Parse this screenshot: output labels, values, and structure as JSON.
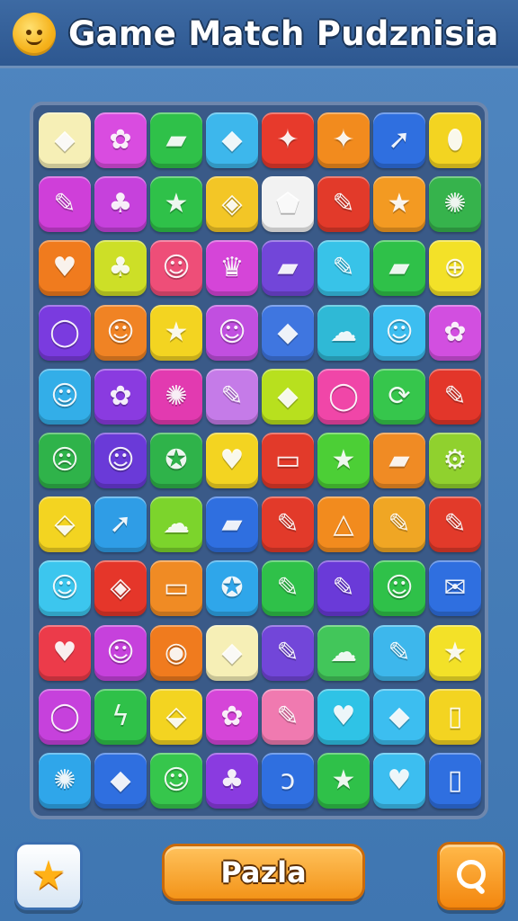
{
  "header": {
    "title": "Game Match Pudznisia",
    "icon": "smiley-face-icon"
  },
  "board": {
    "rows": 11,
    "cols": 8,
    "tiles": [
      [
        {
          "c": "#f6efb6",
          "g": "◆",
          "n": "gem"
        },
        {
          "c": "#d94ce0",
          "g": "✿",
          "n": "flower"
        },
        {
          "c": "#2fc149",
          "g": "▰",
          "n": "block"
        },
        {
          "c": "#3db7ec",
          "g": "◆",
          "n": "gem"
        },
        {
          "c": "#e73a2c",
          "g": "✦",
          "n": "splash"
        },
        {
          "c": "#f28b1e",
          "g": "✦",
          "n": "star-burst"
        },
        {
          "c": "#2f6fe0",
          "g": "➚",
          "n": "arrow"
        },
        {
          "c": "#f3d421",
          "g": "⬮",
          "n": "oval"
        }
      ],
      [
        {
          "c": "#cf3fd9",
          "g": "✎",
          "n": "brush"
        },
        {
          "c": "#c641dc",
          "g": "♣",
          "n": "sprout"
        },
        {
          "c": "#2fc149",
          "g": "★",
          "n": "star"
        },
        {
          "c": "#f3c626",
          "g": "◈",
          "n": "diamond"
        },
        {
          "c": "#f2f2f2",
          "g": "⬟",
          "n": "pentagon"
        },
        {
          "c": "#e23a2a",
          "g": "✎",
          "n": "pencil"
        },
        {
          "c": "#f39a22",
          "g": "★",
          "n": "star"
        },
        {
          "c": "#36b34c",
          "g": "✺",
          "n": "gear"
        }
      ],
      [
        {
          "c": "#f07b1e",
          "g": "♥",
          "n": "heart"
        },
        {
          "c": "#cddf27",
          "g": "♣",
          "n": "leaf"
        },
        {
          "c": "#ee4e78",
          "g": "☺",
          "n": "smiley"
        },
        {
          "c": "#d545d8",
          "g": "♛",
          "n": "crown"
        },
        {
          "c": "#7246d9",
          "g": "▰",
          "n": "block"
        },
        {
          "c": "#38c3e8",
          "g": "✎",
          "n": "wand"
        },
        {
          "c": "#2fc149",
          "g": "▰",
          "n": "bar"
        },
        {
          "c": "#f3e128",
          "g": "⊕",
          "n": "target"
        }
      ],
      [
        {
          "c": "#7a3bdf",
          "g": "◯",
          "n": "ring"
        },
        {
          "c": "#f08324",
          "g": "☺",
          "n": "smiley"
        },
        {
          "c": "#f3d421",
          "g": "★",
          "n": "star"
        },
        {
          "c": "#c14fe0",
          "g": "☺",
          "n": "smiley"
        },
        {
          "c": "#3f76e0",
          "g": "◆",
          "n": "gem"
        },
        {
          "c": "#2fb9d6",
          "g": "☁",
          "n": "cloud"
        },
        {
          "c": "#3cbef0",
          "g": "☺",
          "n": "smiley"
        },
        {
          "c": "#d24fe0",
          "g": "✿",
          "n": "flower"
        }
      ],
      [
        {
          "c": "#33aee8",
          "g": "☺",
          "n": "smiley"
        },
        {
          "c": "#8a3be0",
          "g": "✿",
          "n": "bloom"
        },
        {
          "c": "#e23ab0",
          "g": "✺",
          "n": "gear"
        },
        {
          "c": "#c57be8",
          "g": "✎",
          "n": "eraser"
        },
        {
          "c": "#b8e01e",
          "g": "◆",
          "n": "gem"
        },
        {
          "c": "#f046a8",
          "g": "◯",
          "n": "ring"
        },
        {
          "c": "#36c64c",
          "g": "⟳",
          "n": "refresh"
        },
        {
          "c": "#e3362a",
          "g": "✎",
          "n": "pen"
        }
      ],
      [
        {
          "c": "#2fb34a",
          "g": "☹",
          "n": "face"
        },
        {
          "c": "#6a3ad8",
          "g": "☺",
          "n": "smiley"
        },
        {
          "c": "#2fb34a",
          "g": "✪",
          "n": "coin"
        },
        {
          "c": "#f3d421",
          "g": "♥",
          "n": "heart"
        },
        {
          "c": "#e23a2a",
          "g": "▭",
          "n": "screen"
        },
        {
          "c": "#4ccf36",
          "g": "★",
          "n": "star"
        },
        {
          "c": "#f08b24",
          "g": "▰",
          "n": "box"
        },
        {
          "c": "#90d12e",
          "g": "⚙",
          "n": "gear"
        }
      ],
      [
        {
          "c": "#f3d421",
          "g": "⬙",
          "n": "frame"
        },
        {
          "c": "#2f9de6",
          "g": "➚",
          "n": "arrow"
        },
        {
          "c": "#7cd42c",
          "g": "☁",
          "n": "bubble"
        },
        {
          "c": "#2f6fe0",
          "g": "▰",
          "n": "block"
        },
        {
          "c": "#e23a2a",
          "g": "✎",
          "n": "clip"
        },
        {
          "c": "#f28b1e",
          "g": "△",
          "n": "triangle"
        },
        {
          "c": "#f0a624",
          "g": "✎",
          "n": "marker"
        },
        {
          "c": "#e23a2a",
          "g": "✎",
          "n": "hammer"
        }
      ],
      [
        {
          "c": "#3cc6ee",
          "g": "☺",
          "n": "smiley"
        },
        {
          "c": "#e5362a",
          "g": "◈",
          "n": "diamond"
        },
        {
          "c": "#f08b24",
          "g": "▭",
          "n": "card"
        },
        {
          "c": "#2fa6ea",
          "g": "✪",
          "n": "swirl"
        },
        {
          "c": "#2fc149",
          "g": "✎",
          "n": "whistle"
        },
        {
          "c": "#6a3ad8",
          "g": "✎",
          "n": "crayon"
        },
        {
          "c": "#2fc149",
          "g": "☺",
          "n": "smiley"
        },
        {
          "c": "#2f6fe0",
          "g": "✉",
          "n": "envelope"
        }
      ],
      [
        {
          "c": "#ec3b4a",
          "g": "♥",
          "n": "heart"
        },
        {
          "c": "#c641dc",
          "g": "☺",
          "n": "alien"
        },
        {
          "c": "#f07b1e",
          "g": "◉",
          "n": "button"
        },
        {
          "c": "#f6efb6",
          "g": "◆",
          "n": "leaf"
        },
        {
          "c": "#7246d9",
          "g": "✎",
          "n": "wand"
        },
        {
          "c": "#42c65a",
          "g": "☁",
          "n": "cloud"
        },
        {
          "c": "#3db7ec",
          "g": "✎",
          "n": "pencil"
        },
        {
          "c": "#f3e128",
          "g": "★",
          "n": "star"
        }
      ],
      [
        {
          "c": "#c641dc",
          "g": "◯",
          "n": "ring"
        },
        {
          "c": "#2fc149",
          "g": "ϟ",
          "n": "bolt"
        },
        {
          "c": "#f3d421",
          "g": "⬙",
          "n": "bell"
        },
        {
          "c": "#d545d8",
          "g": "✿",
          "n": "blob"
        },
        {
          "c": "#f07ab0",
          "g": "✎",
          "n": "torch"
        },
        {
          "c": "#2fc3e6",
          "g": "♥",
          "n": "heart"
        },
        {
          "c": "#3cbef0",
          "g": "◆",
          "n": "gem"
        },
        {
          "c": "#f3d421",
          "g": "▯",
          "n": "phone"
        }
      ],
      [
        {
          "c": "#2fa6ea",
          "g": "✺",
          "n": "gear"
        },
        {
          "c": "#2f6fe0",
          "g": "◆",
          "n": "gem"
        },
        {
          "c": "#36c64c",
          "g": "☺",
          "n": "smiley"
        },
        {
          "c": "#8a3be0",
          "g": "♣",
          "n": "sprout"
        },
        {
          "c": "#2f6fe0",
          "g": "ↄ",
          "n": "hook"
        },
        {
          "c": "#2fc149",
          "g": "★",
          "n": "star"
        },
        {
          "c": "#3cbef0",
          "g": "♥",
          "n": "heart"
        },
        {
          "c": "#2f6fe0",
          "g": "▯",
          "n": "phone"
        }
      ]
    ]
  },
  "footer": {
    "star_button_icon": "star-icon",
    "main_button_label": "Pazla",
    "search_button_icon": "magnifier-icon"
  },
  "colors": {
    "background": "#4a80bb",
    "board": "#3a5a88",
    "accent": "#f39419"
  }
}
